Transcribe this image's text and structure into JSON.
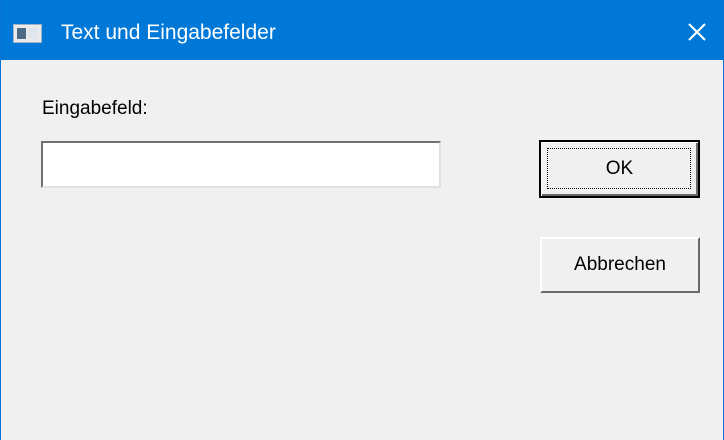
{
  "window": {
    "title": "Text und Eingabefelder",
    "accent_color": "#0078d7",
    "icon": "app-window-icon"
  },
  "form": {
    "label": "Eingabefeld:",
    "input_value": "",
    "input_placeholder": ""
  },
  "buttons": {
    "ok_label": "OK",
    "cancel_label": "Abbrechen"
  },
  "titlebar_controls": {
    "close_icon": "close-icon"
  }
}
